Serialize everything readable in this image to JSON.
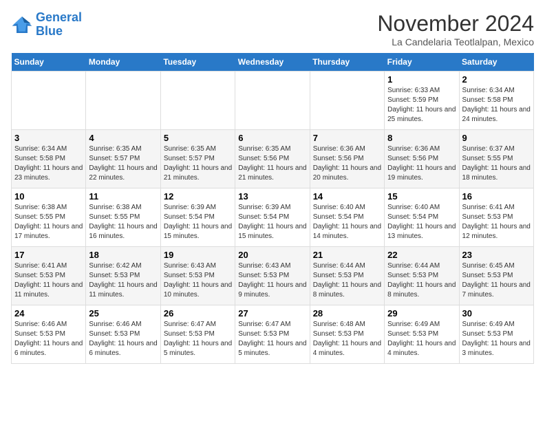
{
  "header": {
    "logo": {
      "line1": "General",
      "line2": "Blue"
    },
    "title": "November 2024",
    "location": "La Candelaria Teotlalpan, Mexico"
  },
  "weekdays": [
    "Sunday",
    "Monday",
    "Tuesday",
    "Wednesday",
    "Thursday",
    "Friday",
    "Saturday"
  ],
  "weeks": [
    [
      {
        "day": null,
        "info": null
      },
      {
        "day": null,
        "info": null
      },
      {
        "day": null,
        "info": null
      },
      {
        "day": null,
        "info": null
      },
      {
        "day": null,
        "info": null
      },
      {
        "day": "1",
        "info": "Sunrise: 6:33 AM\nSunset: 5:59 PM\nDaylight: 11 hours and 25 minutes."
      },
      {
        "day": "2",
        "info": "Sunrise: 6:34 AM\nSunset: 5:58 PM\nDaylight: 11 hours and 24 minutes."
      }
    ],
    [
      {
        "day": "3",
        "info": "Sunrise: 6:34 AM\nSunset: 5:58 PM\nDaylight: 11 hours and 23 minutes."
      },
      {
        "day": "4",
        "info": "Sunrise: 6:35 AM\nSunset: 5:57 PM\nDaylight: 11 hours and 22 minutes."
      },
      {
        "day": "5",
        "info": "Sunrise: 6:35 AM\nSunset: 5:57 PM\nDaylight: 11 hours and 21 minutes."
      },
      {
        "day": "6",
        "info": "Sunrise: 6:35 AM\nSunset: 5:56 PM\nDaylight: 11 hours and 21 minutes."
      },
      {
        "day": "7",
        "info": "Sunrise: 6:36 AM\nSunset: 5:56 PM\nDaylight: 11 hours and 20 minutes."
      },
      {
        "day": "8",
        "info": "Sunrise: 6:36 AM\nSunset: 5:56 PM\nDaylight: 11 hours and 19 minutes."
      },
      {
        "day": "9",
        "info": "Sunrise: 6:37 AM\nSunset: 5:55 PM\nDaylight: 11 hours and 18 minutes."
      }
    ],
    [
      {
        "day": "10",
        "info": "Sunrise: 6:38 AM\nSunset: 5:55 PM\nDaylight: 11 hours and 17 minutes."
      },
      {
        "day": "11",
        "info": "Sunrise: 6:38 AM\nSunset: 5:55 PM\nDaylight: 11 hours and 16 minutes."
      },
      {
        "day": "12",
        "info": "Sunrise: 6:39 AM\nSunset: 5:54 PM\nDaylight: 11 hours and 15 minutes."
      },
      {
        "day": "13",
        "info": "Sunrise: 6:39 AM\nSunset: 5:54 PM\nDaylight: 11 hours and 15 minutes."
      },
      {
        "day": "14",
        "info": "Sunrise: 6:40 AM\nSunset: 5:54 PM\nDaylight: 11 hours and 14 minutes."
      },
      {
        "day": "15",
        "info": "Sunrise: 6:40 AM\nSunset: 5:54 PM\nDaylight: 11 hours and 13 minutes."
      },
      {
        "day": "16",
        "info": "Sunrise: 6:41 AM\nSunset: 5:53 PM\nDaylight: 11 hours and 12 minutes."
      }
    ],
    [
      {
        "day": "17",
        "info": "Sunrise: 6:41 AM\nSunset: 5:53 PM\nDaylight: 11 hours and 11 minutes."
      },
      {
        "day": "18",
        "info": "Sunrise: 6:42 AM\nSunset: 5:53 PM\nDaylight: 11 hours and 11 minutes."
      },
      {
        "day": "19",
        "info": "Sunrise: 6:43 AM\nSunset: 5:53 PM\nDaylight: 11 hours and 10 minutes."
      },
      {
        "day": "20",
        "info": "Sunrise: 6:43 AM\nSunset: 5:53 PM\nDaylight: 11 hours and 9 minutes."
      },
      {
        "day": "21",
        "info": "Sunrise: 6:44 AM\nSunset: 5:53 PM\nDaylight: 11 hours and 8 minutes."
      },
      {
        "day": "22",
        "info": "Sunrise: 6:44 AM\nSunset: 5:53 PM\nDaylight: 11 hours and 8 minutes."
      },
      {
        "day": "23",
        "info": "Sunrise: 6:45 AM\nSunset: 5:53 PM\nDaylight: 11 hours and 7 minutes."
      }
    ],
    [
      {
        "day": "24",
        "info": "Sunrise: 6:46 AM\nSunset: 5:53 PM\nDaylight: 11 hours and 6 minutes."
      },
      {
        "day": "25",
        "info": "Sunrise: 6:46 AM\nSunset: 5:53 PM\nDaylight: 11 hours and 6 minutes."
      },
      {
        "day": "26",
        "info": "Sunrise: 6:47 AM\nSunset: 5:53 PM\nDaylight: 11 hours and 5 minutes."
      },
      {
        "day": "27",
        "info": "Sunrise: 6:47 AM\nSunset: 5:53 PM\nDaylight: 11 hours and 5 minutes."
      },
      {
        "day": "28",
        "info": "Sunrise: 6:48 AM\nSunset: 5:53 PM\nDaylight: 11 hours and 4 minutes."
      },
      {
        "day": "29",
        "info": "Sunrise: 6:49 AM\nSunset: 5:53 PM\nDaylight: 11 hours and 4 minutes."
      },
      {
        "day": "30",
        "info": "Sunrise: 6:49 AM\nSunset: 5:53 PM\nDaylight: 11 hours and 3 minutes."
      }
    ]
  ]
}
